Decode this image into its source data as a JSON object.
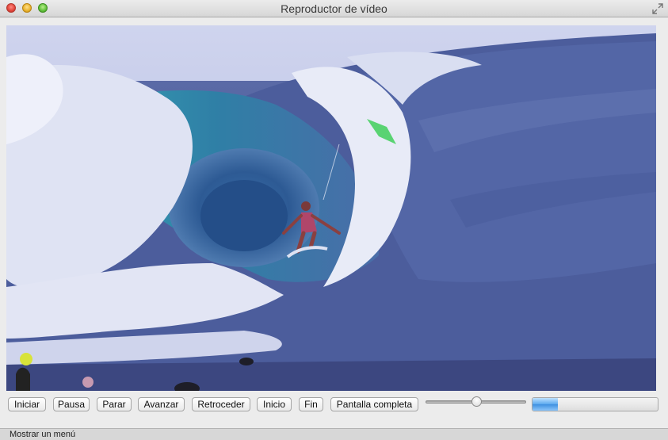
{
  "window": {
    "title": "Reproductor de vídeo"
  },
  "video": {
    "content_icon": "surfer-wave-video-frame"
  },
  "controls": {
    "buttons": [
      {
        "label": "Iniciar"
      },
      {
        "label": "Pausa"
      },
      {
        "label": "Parar"
      },
      {
        "label": "Avanzar"
      },
      {
        "label": "Retroceder"
      },
      {
        "label": "Inicio"
      },
      {
        "label": "Fin"
      },
      {
        "label": "Pantalla completa"
      }
    ],
    "volume_level": 0.51,
    "playback_progress": 0.2
  },
  "status": {
    "text": "Mostrar un menú"
  },
  "colors": {
    "accent": "#4a9be8",
    "titlebar": "#dcdcdc"
  }
}
